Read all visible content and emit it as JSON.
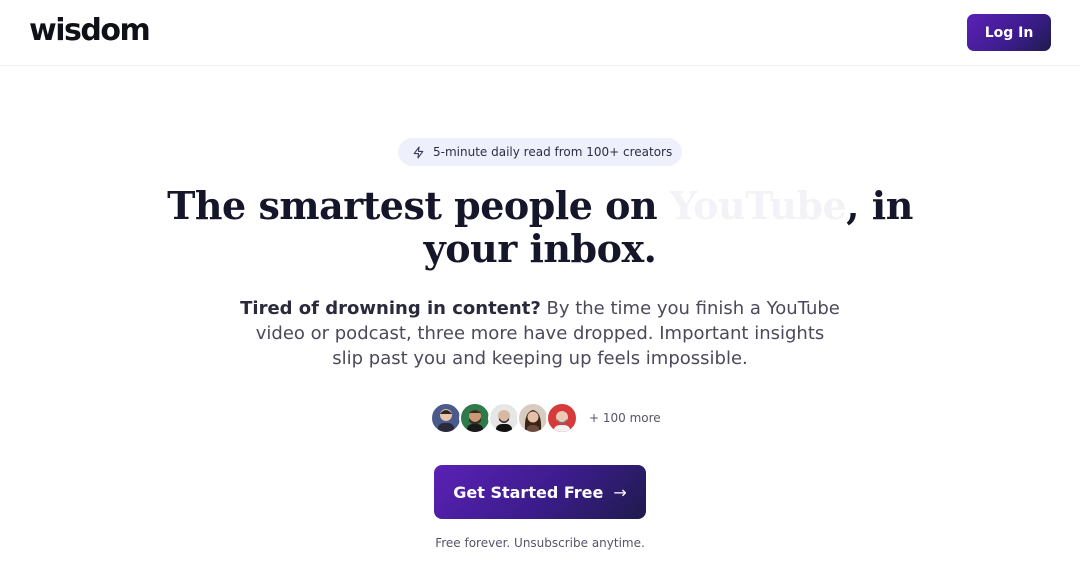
{
  "header": {
    "logo": "wisdom",
    "login_label": "Log In"
  },
  "hero": {
    "badge_icon": "lightning-icon",
    "badge_text": "5-minute daily read from 100+ creators",
    "headline_part1": "The smartest people on ",
    "headline_rotating": "YouTube",
    "headline_part2": ", in your inbox.",
    "subtext_bold": "Tired of drowning in content?",
    "subtext_rest": " By the time you finish a YouTube video or podcast, three more have dropped. Important insights slip past you and keeping up feels impossible.",
    "more_creators": "+ 100 more",
    "cta_label": "Get Started Free",
    "cta_icon": "arrow-right-icon",
    "footnote": "Free forever. Unsubscribe anytime."
  },
  "creators": [
    {
      "name": "creator-avatar-1",
      "color": "#4a5a8c"
    },
    {
      "name": "creator-avatar-2",
      "color": "#2f7a4a"
    },
    {
      "name": "creator-avatar-3",
      "color": "#d9d9d9"
    },
    {
      "name": "creator-avatar-4",
      "color": "#c9b8a8"
    },
    {
      "name": "creator-avatar-5",
      "color": "#d63a3a"
    }
  ],
  "colors": {
    "brand_gradient_start": "#5b21b6",
    "brand_gradient_end": "#1e1b4b",
    "badge_bg": "#eef0fb"
  }
}
